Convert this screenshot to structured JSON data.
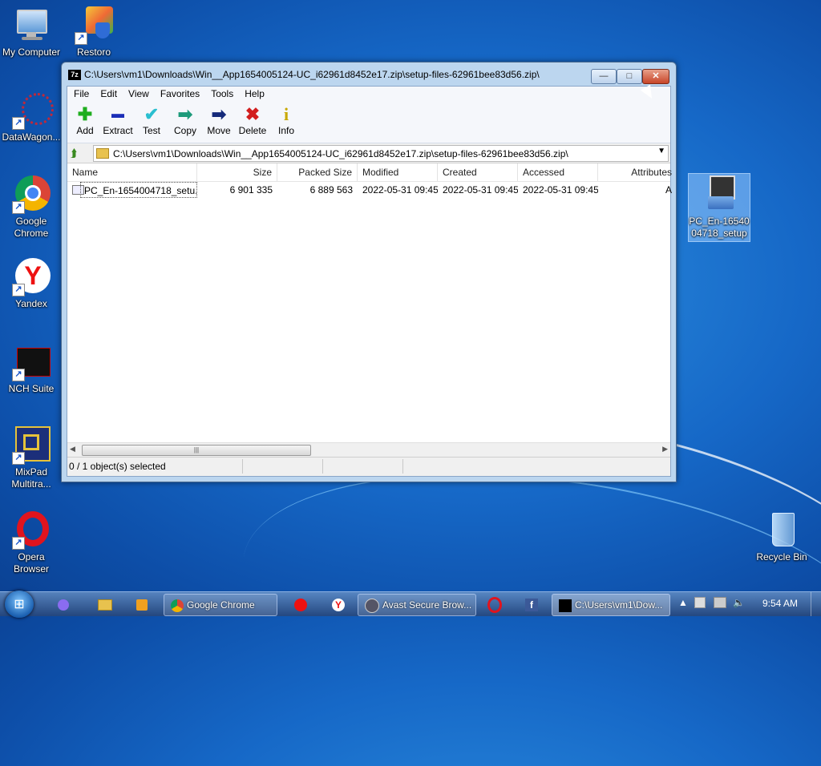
{
  "desktop": {
    "icons": [
      {
        "label": "My Computer"
      },
      {
        "label": "Restoro"
      },
      {
        "label": "DataWagon..."
      },
      {
        "label": "Google Chrome"
      },
      {
        "label": "Yandex"
      },
      {
        "label": "NCH Suite"
      },
      {
        "label": "MixPad Multitra..."
      },
      {
        "label": "Opera Browser"
      },
      {
        "label": "Recycle Bin"
      },
      {
        "label": "PC_En-1654004718_setup"
      }
    ]
  },
  "window": {
    "title": "C:\\Users\\vm1\\Downloads\\Win__App1654005124-UC_i62961d8452e17.zip\\setup-files-62961bee83d56.zip\\",
    "app_icon": "7z",
    "controls": {
      "minimize": "—",
      "maximize": "□",
      "close": "✕"
    },
    "menu": [
      "File",
      "Edit",
      "View",
      "Favorites",
      "Tools",
      "Help"
    ],
    "toolbar": [
      {
        "label": "Add",
        "icon": "plus-icon",
        "glyph": "✚",
        "color": "#1fae1f"
      },
      {
        "label": "Extract",
        "icon": "minus-icon",
        "glyph": "▬",
        "color": "#1c2fb8"
      },
      {
        "label": "Test",
        "icon": "check-icon",
        "glyph": "✔",
        "color": "#2abfd0"
      },
      {
        "label": "Copy",
        "icon": "double-arrow-icon",
        "glyph": "➡",
        "color": "#1c9a7a"
      },
      {
        "label": "Move",
        "icon": "arrow-right-icon",
        "glyph": "➡",
        "color": "#152a7a"
      },
      {
        "label": "Delete",
        "icon": "x-icon",
        "glyph": "✖",
        "color": "#d21e1e"
      },
      {
        "label": "Info",
        "icon": "info-icon",
        "glyph": "i",
        "color": "#c8a800"
      }
    ],
    "address": "C:\\Users\\vm1\\Downloads\\Win__App1654005124-UC_i62961d8452e17.zip\\setup-files-62961bee83d56.zip\\",
    "columns": [
      "Name",
      "Size",
      "Packed Size",
      "Modified",
      "Created",
      "Accessed",
      "Attributes"
    ],
    "rows": [
      [
        "PC_En-1654004718_setu...",
        "6 901 335",
        "6 889 563",
        "2022-05-31 09:45",
        "2022-05-31 09:45",
        "2022-05-31 09:45",
        "A"
      ]
    ],
    "status": "0 / 1 object(s) selected",
    "scroll_thumb": "|||"
  },
  "taskbar": {
    "start": "⊞",
    "tasks": [
      {
        "label": "Google Chrome"
      },
      {
        "label": "Avast Secure Brow..."
      },
      {
        "label": "C:\\Users\\vm1\\Dow..."
      }
    ],
    "clock": "9:54 AM"
  }
}
